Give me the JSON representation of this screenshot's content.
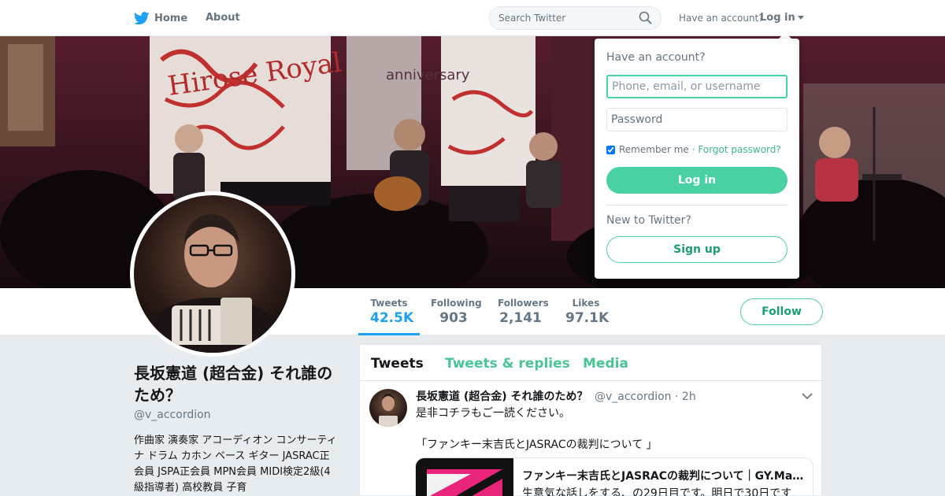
{
  "nav": {
    "home_label": "Home",
    "about_label": "About",
    "search_placeholder": "Search Twitter",
    "have_account_text": "Have an account?",
    "login_label": "Log in"
  },
  "profile": {
    "name": "長坂憲道 (超合金) それ誰のため？",
    "handle": "@v_accordion",
    "bio": "作曲家 演奏家 アコーディオン コンサーティナ ドラム カホン ベース ギター JASRAC正会員 JSPA正会員 MPN会員 MIDI検定2級(4級指導者) 高校教員 子育",
    "follow_label": "Follow"
  },
  "stats": [
    {
      "label": "Tweets",
      "value": "42.5K",
      "active": true
    },
    {
      "label": "Following",
      "value": "903",
      "active": false
    },
    {
      "label": "Followers",
      "value": "2,141",
      "active": false
    },
    {
      "label": "Likes",
      "value": "97.1K",
      "active": false
    }
  ],
  "timeline": {
    "tabs": [
      "Tweets",
      "Tweets & replies",
      "Media"
    ],
    "tweet": {
      "name": "長坂憲道 (超合金) それ誰のため？",
      "handle": "@v_accordion",
      "time": "· 2h",
      "text1": "是非コチラもご一読ください。",
      "text2": "「ファンキー末吉氏とJASRACの裁判について 」",
      "card_title": "ファンキー末吉氏とJASRACの裁判について｜GY.Matsumoto｜note",
      "card_desc": "生意気な話しをする、の29日目です。明日で30日です"
    }
  },
  "login_dropdown": {
    "heading": "Have an account?",
    "username_placeholder": "Phone, email, or username",
    "password_placeholder": "Password",
    "remember_label": "Remember me",
    "forgot_label": "· Forgot password?",
    "login_button": "Log in",
    "new_heading": "New to Twitter?",
    "signup_button": "Sign up"
  },
  "cover_text": {
    "left": "Hirose Royal",
    "center": "anniversary"
  },
  "colors": {
    "accent": "#4ad1a3",
    "twitter_blue": "#1da1f2",
    "background": "#e6ecf0"
  }
}
